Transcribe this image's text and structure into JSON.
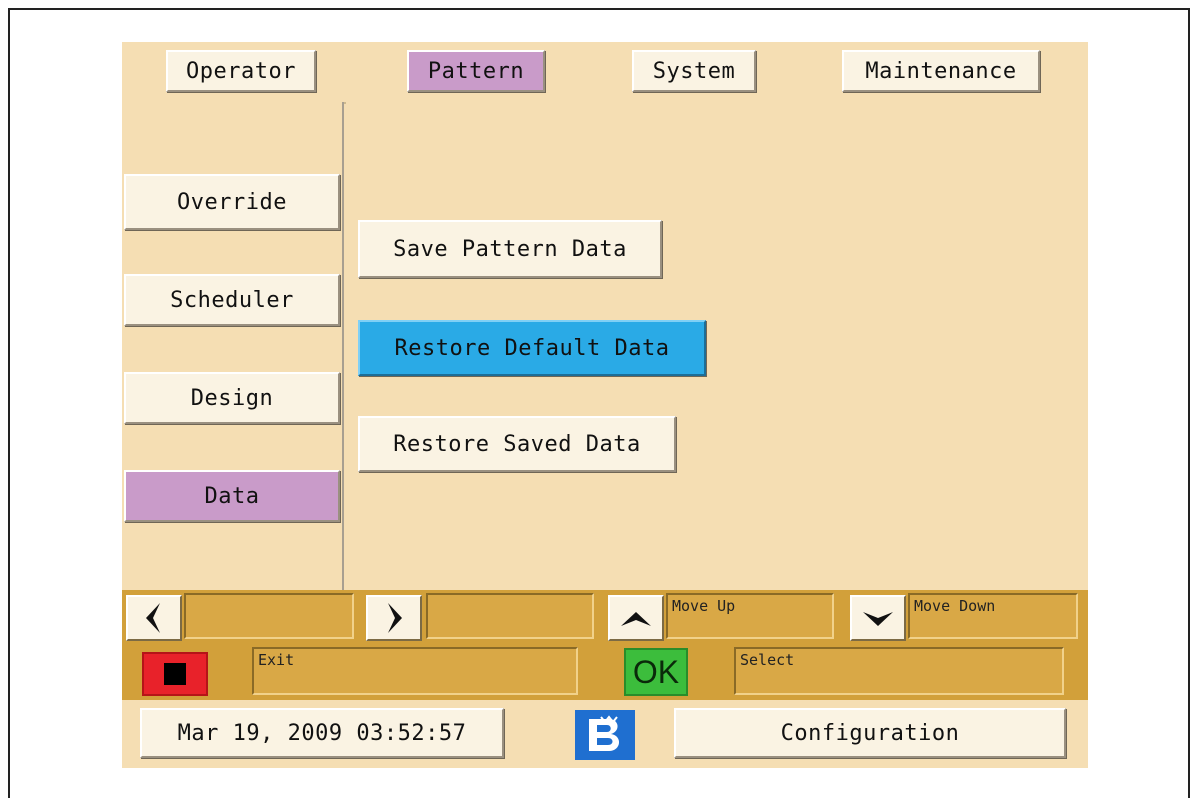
{
  "tabs": [
    {
      "label": "Operator",
      "active": false
    },
    {
      "label": "Pattern",
      "active": true
    },
    {
      "label": "System",
      "active": false
    },
    {
      "label": "Maintenance",
      "active": false
    }
  ],
  "sidebar": {
    "items": [
      {
        "label": "Override",
        "active": false
      },
      {
        "label": "Scheduler",
        "active": false
      },
      {
        "label": "Design",
        "active": false
      },
      {
        "label": "Data",
        "active": true
      }
    ]
  },
  "main": {
    "buttons": [
      {
        "label": "Save Pattern Data",
        "selected": false
      },
      {
        "label": "Restore Default Data",
        "selected": true
      },
      {
        "label": "Restore Saved Data",
        "selected": false
      }
    ]
  },
  "navbar": {
    "left_field": "",
    "right_field": "",
    "up_label": "Move Up",
    "down_label": "Move Down"
  },
  "actionbar": {
    "exit_label": "Exit",
    "ok_text": "OK",
    "select_label": "Select"
  },
  "statusbar": {
    "datetime": "Mar 19, 2009 03:52:57",
    "config_label": "Configuration"
  },
  "colors": {
    "background": "#f5deb3",
    "active_purple": "#c99bc9",
    "selected_blue": "#2aaae6",
    "bar_gold": "#d2a03a",
    "stop_red": "#e8222a",
    "ok_green": "#3cbd3c",
    "logo_blue": "#1f6fd0"
  },
  "icons": {
    "left": "arrow-left-icon",
    "right": "arrow-right-icon",
    "up": "arrow-up-icon",
    "down": "arrow-down-icon",
    "stop": "stop-icon",
    "logo": "brand-logo-icon"
  }
}
